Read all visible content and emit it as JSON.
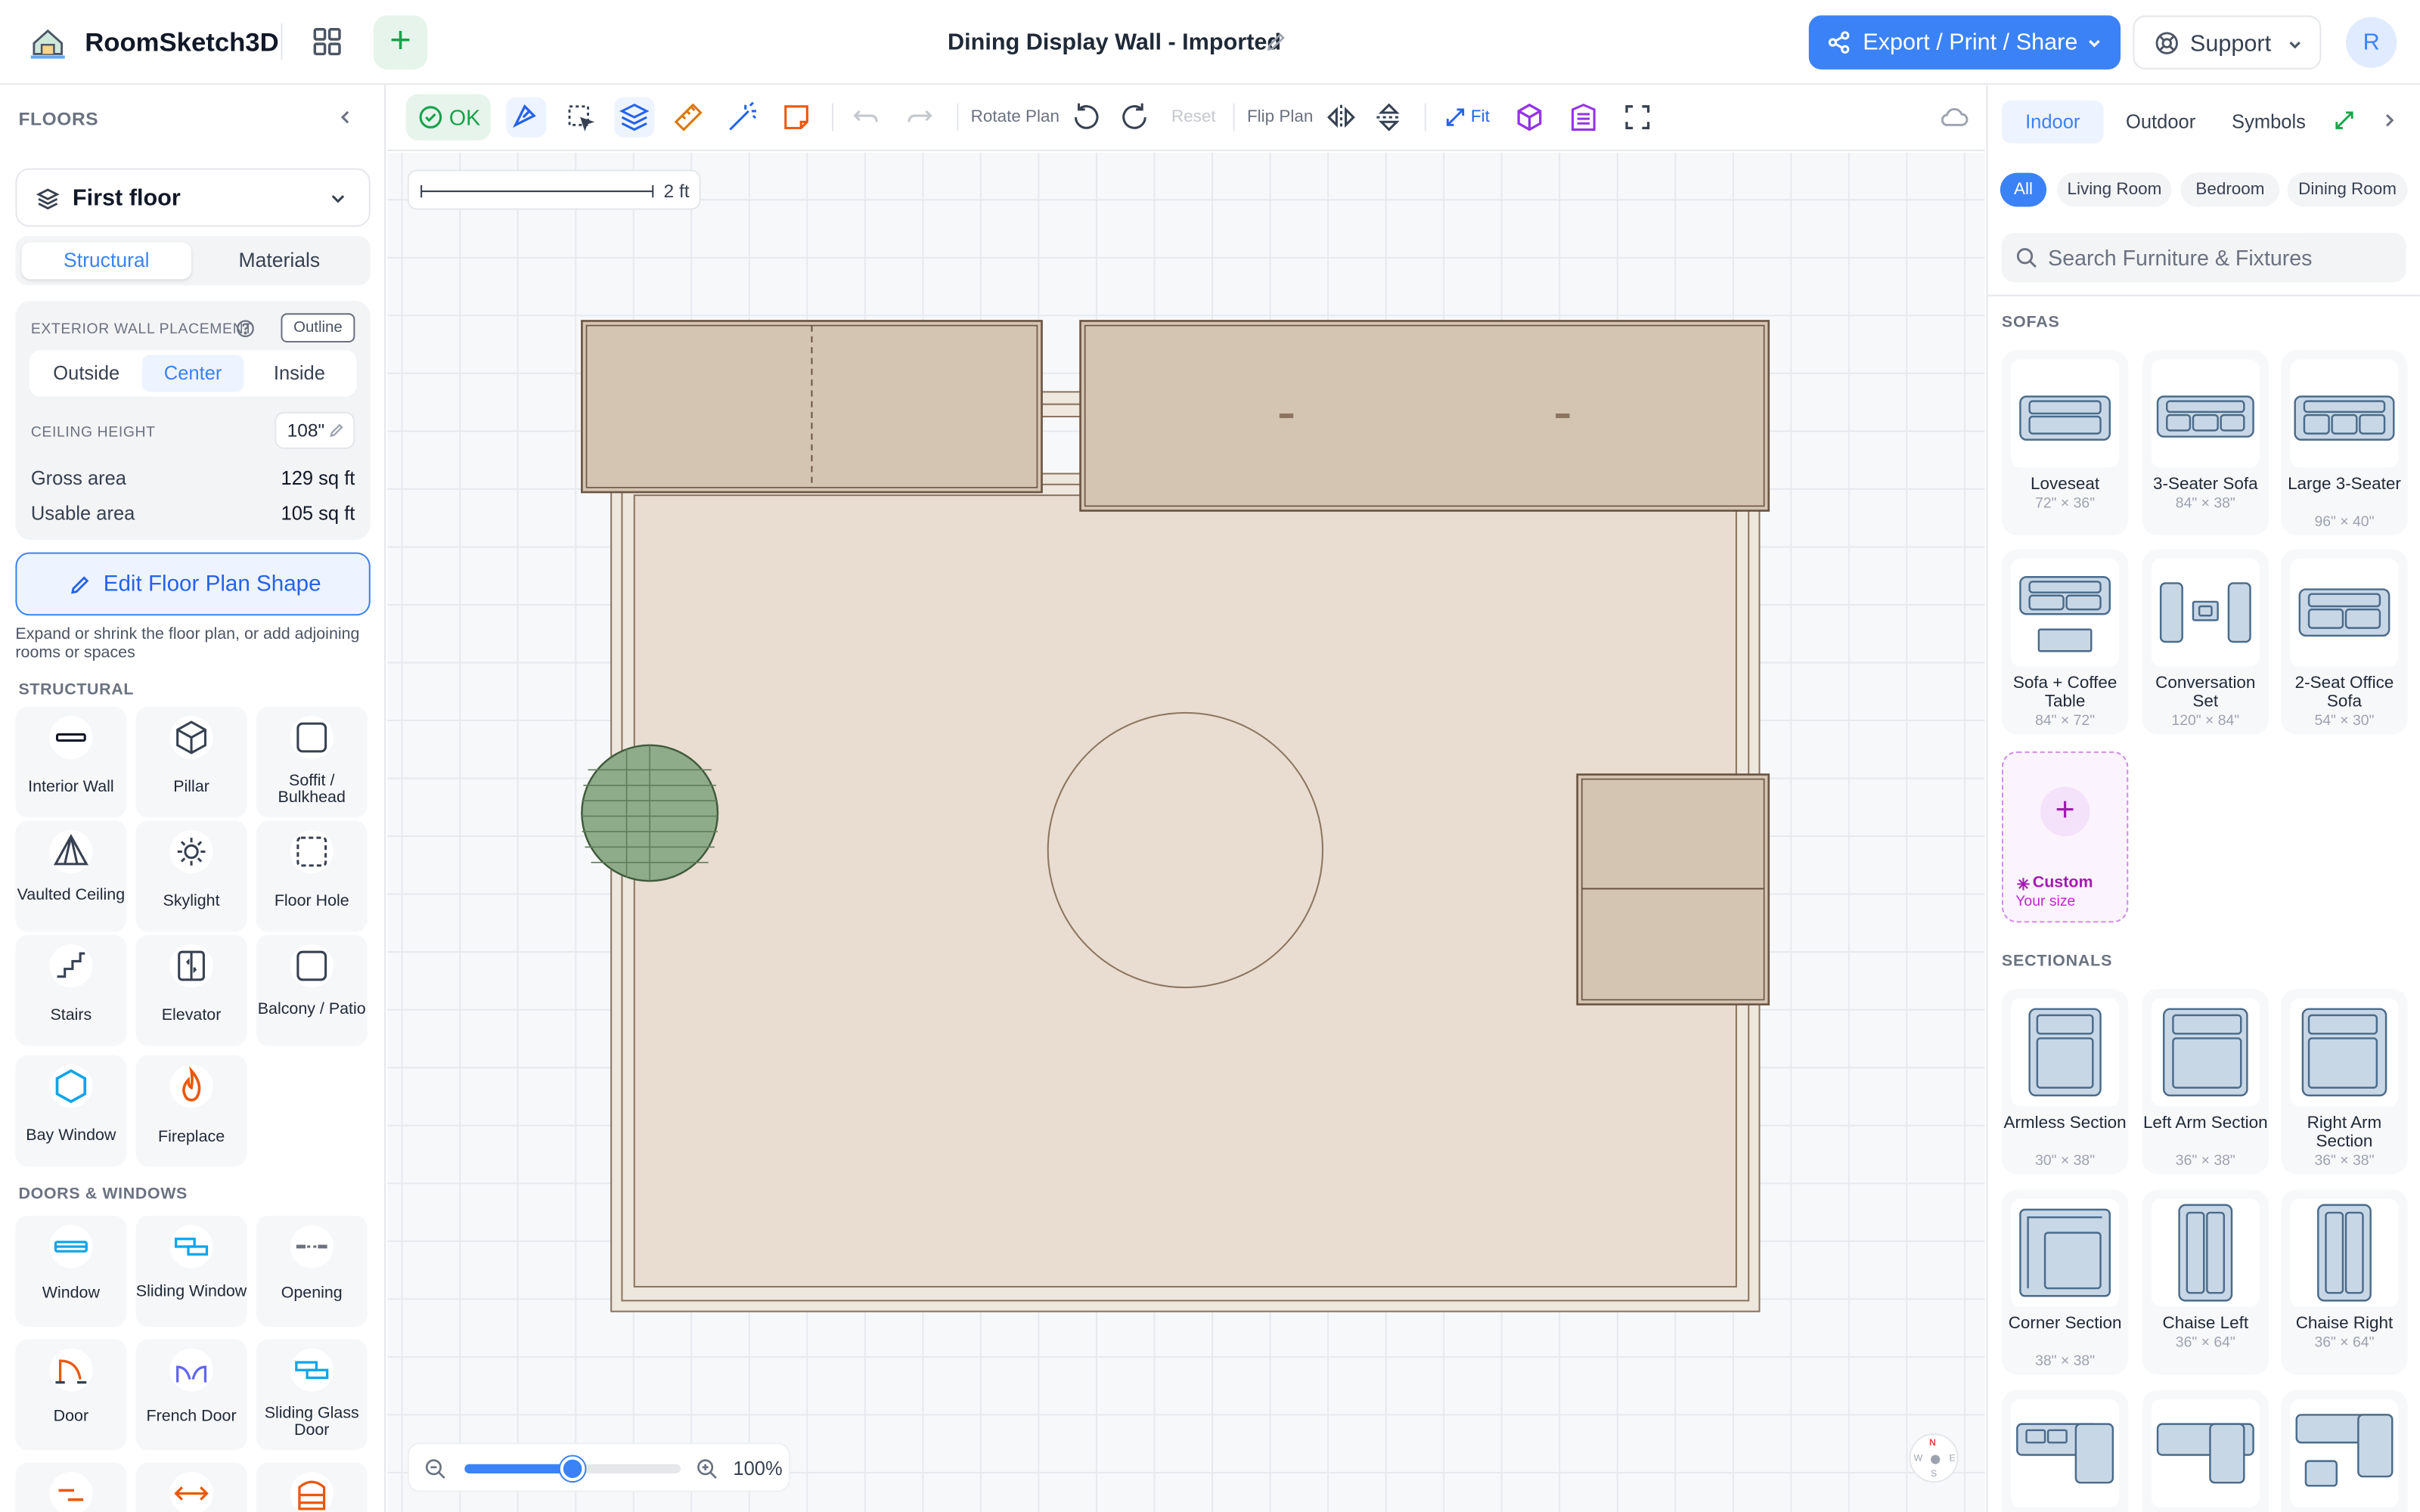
{
  "header": {
    "app_name": "RoomSketch3D",
    "doc_title": "Dining Display Wall - Imported",
    "export_label": "Export / Print / Share",
    "support_label": "Support",
    "avatar_initial": "R"
  },
  "left_panel": {
    "title": "FLOORS",
    "floor_selected": "First floor",
    "tabs": [
      "Structural",
      "Materials"
    ],
    "active_tab": "Structural",
    "wall_placement_label": "EXTERIOR WALL PLACEMENT",
    "outline_tag": "Outline",
    "wall_options": [
      "Outside",
      "Center",
      "Inside"
    ],
    "wall_active": "Center",
    "ceiling_label": "CEILING HEIGHT",
    "ceiling_value": "108\"",
    "gross_label": "Gross area",
    "gross_value": "129 sq ft",
    "usable_label": "Usable area",
    "usable_value": "105 sq ft",
    "edit_shape_label": "Edit Floor Plan Shape",
    "edit_shape_hint": "Expand or shrink the floor plan, or add adjoining rooms or spaces",
    "structural_heading": "STRUCTURAL",
    "structural_items": [
      "Interior Wall",
      "Pillar",
      "Soffit / Bulkhead",
      "Vaulted Ceiling",
      "Skylight",
      "Floor Hole",
      "Stairs",
      "Elevator",
      "Balcony / Patio",
      "Bay Window",
      "Fireplace"
    ],
    "doors_heading": "DOORS & WINDOWS",
    "doors_items": [
      "Window",
      "Sliding Window",
      "Opening",
      "Door",
      "French Door",
      "Sliding Glass Door"
    ]
  },
  "toolbar": {
    "ok_label": "OK",
    "rotate_label": "Rotate Plan",
    "reset_label": "Reset",
    "flip_label": "Flip Plan",
    "fit_label": "Fit"
  },
  "canvas": {
    "scale_label": "2 ft",
    "zoom_percent": "100%",
    "zoom_level": 0.5,
    "compass": {
      "n": "N",
      "s": "S",
      "e": "E",
      "w": "W"
    }
  },
  "right_panel": {
    "tabs": [
      "Indoor",
      "Outdoor",
      "Symbols"
    ],
    "active_tab": "Indoor",
    "chips": [
      "All",
      "Living Room",
      "Bedroom",
      "Dining Room"
    ],
    "active_chip": "All",
    "search_placeholder": "Search Furniture & Fixtures",
    "sofas_heading": "SOFAS",
    "sofas": [
      {
        "name": "Loveseat",
        "dims": "72\" × 36\""
      },
      {
        "name": "3-Seater Sofa",
        "dims": "84\" × 38\""
      },
      {
        "name": "Large 3-Seater",
        "dims": "96\" × 40\""
      },
      {
        "name": "Sofa + Coffee Table",
        "dims": "84\" × 72\""
      },
      {
        "name": "Conversation Set",
        "dims": "120\" × 84\""
      },
      {
        "name": "2-Seat Office Sofa",
        "dims": "54\" × 30\""
      }
    ],
    "custom_label": "Custom",
    "custom_sub": "Your size",
    "sectionals_heading": "SECTIONALS",
    "sectionals": [
      {
        "name": "Armless Section",
        "dims": "30\" × 38\""
      },
      {
        "name": "Left Arm Section",
        "dims": "36\" × 38\""
      },
      {
        "name": "Right Arm Section",
        "dims": "36\" × 38\""
      },
      {
        "name": "Corner Section",
        "dims": "38\" × 38\""
      },
      {
        "name": "Chaise Left",
        "dims": "36\" × 64\""
      },
      {
        "name": "Chaise Right",
        "dims": "36\" × 64\""
      }
    ]
  },
  "colors": {
    "accent": "#3b82f6",
    "ok_green": "#16a34a",
    "floor_fill": "#e8ddd0",
    "wall_stroke": "#8b7560",
    "furniture_fill": "#d4c5b3",
    "plant_fill": "#8fac8a"
  }
}
